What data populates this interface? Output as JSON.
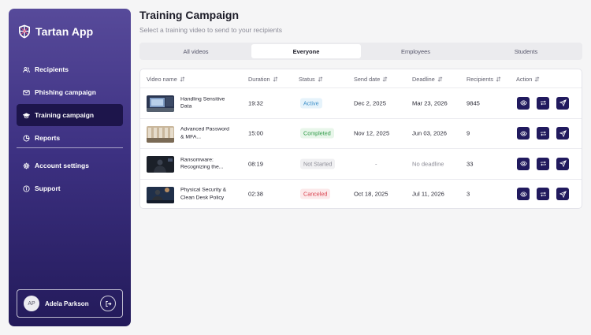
{
  "app": {
    "name": "Tartan App"
  },
  "sidebar": {
    "items": [
      {
        "label": "Recipients",
        "icon": "users-icon"
      },
      {
        "label": "Phishing campaign",
        "icon": "mail-icon"
      },
      {
        "label": "Training campaign",
        "icon": "graduation-cap-icon",
        "active": true
      },
      {
        "label": "Reports",
        "icon": "pie-chart-icon"
      }
    ],
    "bottom_items": [
      {
        "label": "Account settings",
        "icon": "gear-icon"
      },
      {
        "label": "Support",
        "icon": "info-icon"
      }
    ],
    "user": {
      "initials": "AP",
      "name": "Adela Parkson"
    }
  },
  "header": {
    "title": "Training Campaign",
    "subtitle": "Select a training video to send to your recipients"
  },
  "tabs": [
    {
      "label": "All videos"
    },
    {
      "label": "Everyone",
      "active": true
    },
    {
      "label": "Employees"
    },
    {
      "label": "Students"
    }
  ],
  "table": {
    "columns": [
      "Video name",
      "Duration",
      "Status",
      "Send date",
      "Deadline",
      "Recipients",
      "Action"
    ],
    "rows": [
      {
        "name": "Handling Sensitive Data",
        "duration": "19:32",
        "status": "Active",
        "send_date": "Dec 2, 2025",
        "deadline": "Mar 23, 2026",
        "recipients": "9845"
      },
      {
        "name": "Advanced Password & MFA...",
        "duration": "15:00",
        "status": "Completed",
        "send_date": "Nov 12, 2025",
        "deadline": "Jun 03, 2026",
        "recipients": "9"
      },
      {
        "name": "Ransomware: Recognizing the...",
        "duration": "08:19",
        "status": "Not Started",
        "send_date": "-",
        "deadline": "No deadline",
        "recipients": "33"
      },
      {
        "name": "Physical Security & Clean Desk Policy",
        "duration": "02:38",
        "status": "Canceled",
        "send_date": "Oct 18, 2025",
        "deadline": "Jul 11, 2026",
        "recipients": "3"
      }
    ]
  },
  "colors": {
    "sidebar_top": "#574a9a",
    "sidebar_bottom": "#231a5a",
    "action_button": "#211a5e",
    "active_badge": "#3c8fc8",
    "completed_badge": "#2f9a47",
    "canceled_badge": "#d9424e"
  }
}
